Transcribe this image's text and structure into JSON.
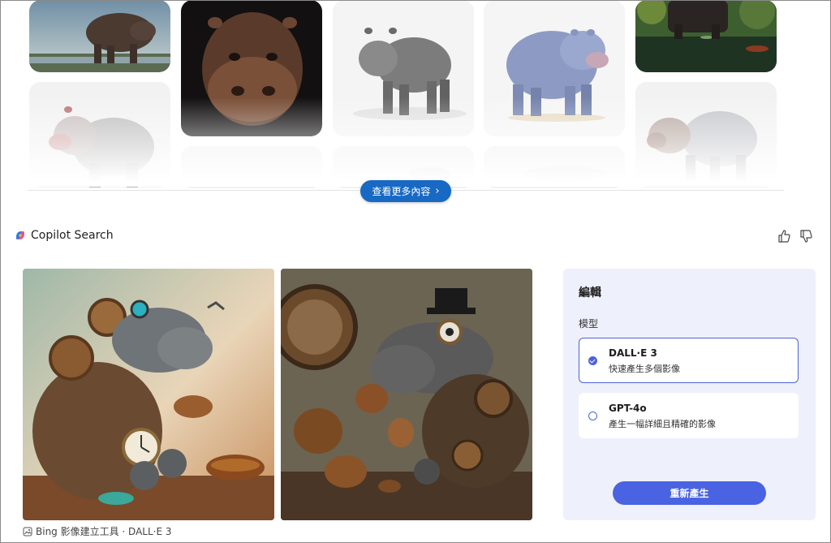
{
  "results": {
    "see_more_label": "查看更多內容",
    "tiles": [
      {
        "name": "hippo-lake"
      },
      {
        "name": "hippo-closeup-dark"
      },
      {
        "name": "hippo-grey-studio"
      },
      {
        "name": "hippo-blue-illustration"
      },
      {
        "name": "hippo-in-water"
      },
      {
        "name": "hippo-pale-left"
      },
      {
        "name": "hippo-pale-right"
      },
      {
        "name": "hippo-faded-1"
      },
      {
        "name": "hippo-faded-2"
      },
      {
        "name": "hippo-faded-3"
      }
    ]
  },
  "copilot": {
    "title": "Copilot Search",
    "like_icon": "thumbs-up-icon",
    "dislike_icon": "thumbs-down-icon"
  },
  "generated": {
    "images": [
      {
        "name": "steampunk-hippo-pouring-tea"
      },
      {
        "name": "steampunk-hippo-top-hat-tea"
      }
    ],
    "caption": "Bing 影像建立工具 · DALL·E 3"
  },
  "edit_panel": {
    "title": "編輯",
    "model_label": "模型",
    "options": [
      {
        "name": "DALL·E 3",
        "description": "快速產生多個影像",
        "selected": true
      },
      {
        "name": "GPT-4o",
        "description": "產生一幅詳細且精確的影像",
        "selected": false
      }
    ],
    "regenerate_label": "重新產生",
    "accent_color": "#4a63e3"
  }
}
